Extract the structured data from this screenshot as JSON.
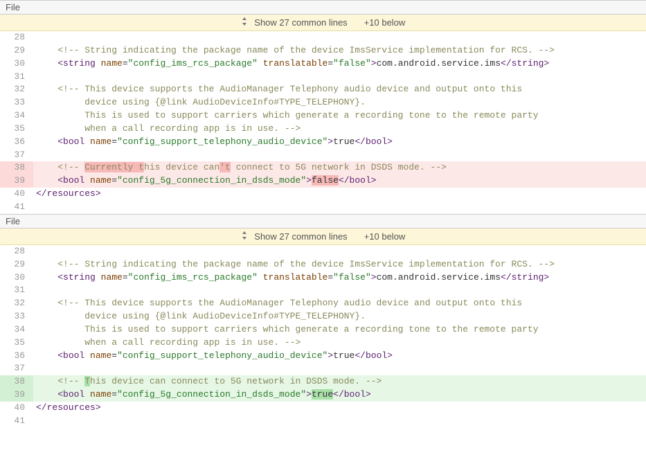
{
  "pane1": {
    "header": "File",
    "expand": {
      "show": "Show 27 common lines",
      "below": "+10 below"
    },
    "lines": [
      {
        "n": 28,
        "html": ""
      },
      {
        "n": 29,
        "html": "    <span class='c-comment'>&lt;!-- String indicating the package name of the device ImsService implementation for RCS. --&gt;</span>"
      },
      {
        "n": 30,
        "html": "    <span class='tag'>&lt;string</span> <span class='brown'>name</span>=<span class='str'>\"config_ims_rcs_package\"</span> <span class='brown'>translatable</span>=<span class='str'>\"false\"</span><span class='tag'>&gt;</span>com.android.service.ims<span class='tag'>&lt;/string&gt;</span>"
      },
      {
        "n": 31,
        "html": ""
      },
      {
        "n": 32,
        "html": "    <span class='c-comment'>&lt;!-- This device supports the AudioManager Telephony audio device and output onto this</span>"
      },
      {
        "n": 33,
        "html": "<span class='c-comment'>         device using {@link AudioDeviceInfo#TYPE_TELEPHONY}.</span>"
      },
      {
        "n": 34,
        "html": "<span class='c-comment'>         This is used to support carriers which generate a recording tone to the remote party</span>"
      },
      {
        "n": 35,
        "html": "<span class='c-comment'>         when a call recording app is in use. --&gt;</span>"
      },
      {
        "n": 36,
        "html": "    <span class='tag'>&lt;bool</span> <span class='brown'>name</span>=<span class='str'>\"config_support_telephony_audio_device\"</span><span class='tag'>&gt;</span>true<span class='tag'>&lt;/bool&gt;</span>"
      },
      {
        "n": 37,
        "html": ""
      },
      {
        "n": 38,
        "cls": "diff-removed",
        "html": "    <span class='c-comment'>&lt;!-- <span class='intra-del'>Currently t</span>his device can<span class='intra-del'>'t</span> connect to 5G network in DSDS mode. --&gt;</span>"
      },
      {
        "n": 39,
        "cls": "diff-removed",
        "html": "    <span class='tag'>&lt;bool</span> <span class='brown'>name</span>=<span class='str'>\"config_5g_connection_in_dsds_mode\"</span><span class='tag'>&gt;</span><span class='intra-del'>false</span><span class='tag'>&lt;/bool&gt;</span>"
      },
      {
        "n": 40,
        "html": "<span class='tag'>&lt;/resources&gt;</span>"
      },
      {
        "n": 41,
        "html": ""
      }
    ]
  },
  "pane2": {
    "header": "File",
    "expand": {
      "show": "Show 27 common lines",
      "below": "+10 below"
    },
    "lines": [
      {
        "n": 28,
        "html": ""
      },
      {
        "n": 29,
        "html": "    <span class='c-comment'>&lt;!-- String indicating the package name of the device ImsService implementation for RCS. --&gt;</span>"
      },
      {
        "n": 30,
        "html": "    <span class='tag'>&lt;string</span> <span class='brown'>name</span>=<span class='str'>\"config_ims_rcs_package\"</span> <span class='brown'>translatable</span>=<span class='str'>\"false\"</span><span class='tag'>&gt;</span>com.android.service.ims<span class='tag'>&lt;/string&gt;</span>"
      },
      {
        "n": 31,
        "html": ""
      },
      {
        "n": 32,
        "html": "    <span class='c-comment'>&lt;!-- This device supports the AudioManager Telephony audio device and output onto this</span>"
      },
      {
        "n": 33,
        "html": "<span class='c-comment'>         device using {@link AudioDeviceInfo#TYPE_TELEPHONY}.</span>"
      },
      {
        "n": 34,
        "html": "<span class='c-comment'>         This is used to support carriers which generate a recording tone to the remote party</span>"
      },
      {
        "n": 35,
        "html": "<span class='c-comment'>         when a call recording app is in use. --&gt;</span>"
      },
      {
        "n": 36,
        "html": "    <span class='tag'>&lt;bool</span> <span class='brown'>name</span>=<span class='str'>\"config_support_telephony_audio_device\"</span><span class='tag'>&gt;</span>true<span class='tag'>&lt;/bool&gt;</span>"
      },
      {
        "n": 37,
        "html": ""
      },
      {
        "n": 38,
        "cls": "diff-added",
        "html": "    <span class='c-comment'>&lt;!-- <span class='intra-add'>T</span>his device can connect to 5G network in DSDS mode. --&gt;</span>"
      },
      {
        "n": 39,
        "cls": "diff-added",
        "html": "    <span class='tag'>&lt;bool</span> <span class='brown'>name</span>=<span class='str'>\"config_5g_connection_in_dsds_mode\"</span><span class='tag'>&gt;</span><span class='intra-add'>true</span><span class='tag'>&lt;/bool&gt;</span>"
      },
      {
        "n": 40,
        "html": "<span class='tag'>&lt;/resources&gt;</span>"
      },
      {
        "n": 41,
        "html": ""
      }
    ]
  }
}
